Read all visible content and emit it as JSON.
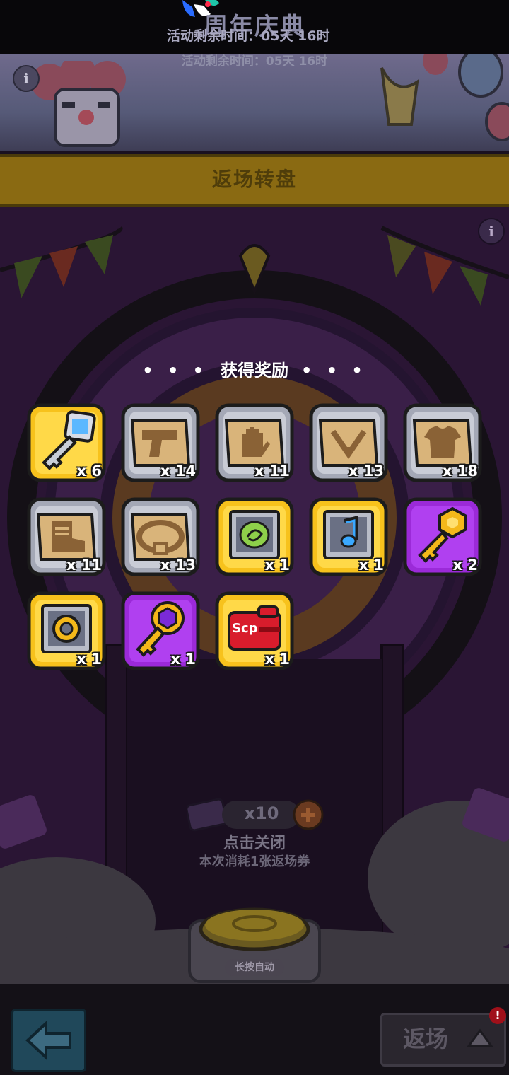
{
  "banner": {
    "title": "周年庆典",
    "remaining_time_overlay": "活动剩余时间：05天 16时",
    "remaining_time": "活动剩余时间：05天 16时",
    "info_symbol": "i"
  },
  "header": {
    "title": "返场转盘"
  },
  "play": {
    "info_symbol": "i"
  },
  "reward_panel": {
    "title": "获得奖励",
    "dots_left": "• • •",
    "dots_right": "• • •",
    "items": [
      {
        "icon": "diamond-key-icon",
        "frame": "gold",
        "count": "x 6"
      },
      {
        "icon": "pistol-blueprint-icon",
        "frame": "silver",
        "count": "x 14"
      },
      {
        "icon": "glove-blueprint-icon",
        "frame": "silver",
        "count": "x 11"
      },
      {
        "icon": "necklace-blueprint-icon",
        "frame": "silver",
        "count": "x 13"
      },
      {
        "icon": "shirt-blueprint-icon",
        "frame": "silver",
        "count": "x 18"
      },
      {
        "icon": "boots-blueprint-icon",
        "frame": "silver",
        "count": "x 11"
      },
      {
        "icon": "belt-blueprint-icon",
        "frame": "silver",
        "count": "x 13"
      },
      {
        "icon": "green-chip-icon",
        "frame": "gold",
        "count": "x 1"
      },
      {
        "icon": "music-note-card-icon",
        "frame": "gold",
        "count": "x 1"
      },
      {
        "icon": "gold-hex-key-icon",
        "frame": "purple",
        "count": "x 2"
      },
      {
        "icon": "speaker-card-icon",
        "frame": "gold",
        "count": "x 1"
      },
      {
        "icon": "purple-gem-key-icon",
        "frame": "purple",
        "count": "x 1"
      },
      {
        "icon": "scp-box-icon",
        "frame": "gold",
        "count": "x 1"
      }
    ]
  },
  "spin": {
    "ticket_count": "x10",
    "click_to_close": "点击关闭",
    "consume_text": "本次消耗1张返场券",
    "auto_label": "长按自动"
  },
  "bottom": {
    "return_label": "返场",
    "badge": "!"
  },
  "colors": {
    "gold_frame": "#f7c21c",
    "silver_frame": "#a4a8b6",
    "purple_frame": "#9b2ad8",
    "play_bg": "#2a1534",
    "header_gold": "#8a6a12"
  }
}
